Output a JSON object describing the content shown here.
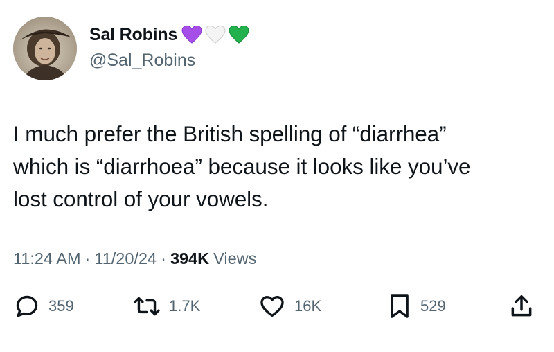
{
  "author": {
    "display_name": "Sal Robins",
    "handle": "@Sal_Robins",
    "avatar_icon": "profile-photo-woman-with-hat",
    "name_emojis": [
      {
        "name": "purple-heart-icon",
        "color": "#a64ee8"
      },
      {
        "name": "white-heart-icon",
        "color": "#f2f2f2"
      },
      {
        "name": "green-heart-icon",
        "color": "#22b14c"
      }
    ]
  },
  "tweet": {
    "lines": [
      "I much prefer the British spelling of “diarrhea”",
      "which is “diarrhoea” because it looks like you’ve",
      "lost control of your vowels."
    ]
  },
  "meta": {
    "time": "11:24 AM",
    "separator": "·",
    "date": "11/20/24",
    "views_count": "394K",
    "views_label": "Views"
  },
  "actions": {
    "replies": "359",
    "reposts": "1.7K",
    "likes": "16K",
    "bookmarks": "529"
  },
  "colors": {
    "text": "#0f1419",
    "secondary": "#536471"
  }
}
